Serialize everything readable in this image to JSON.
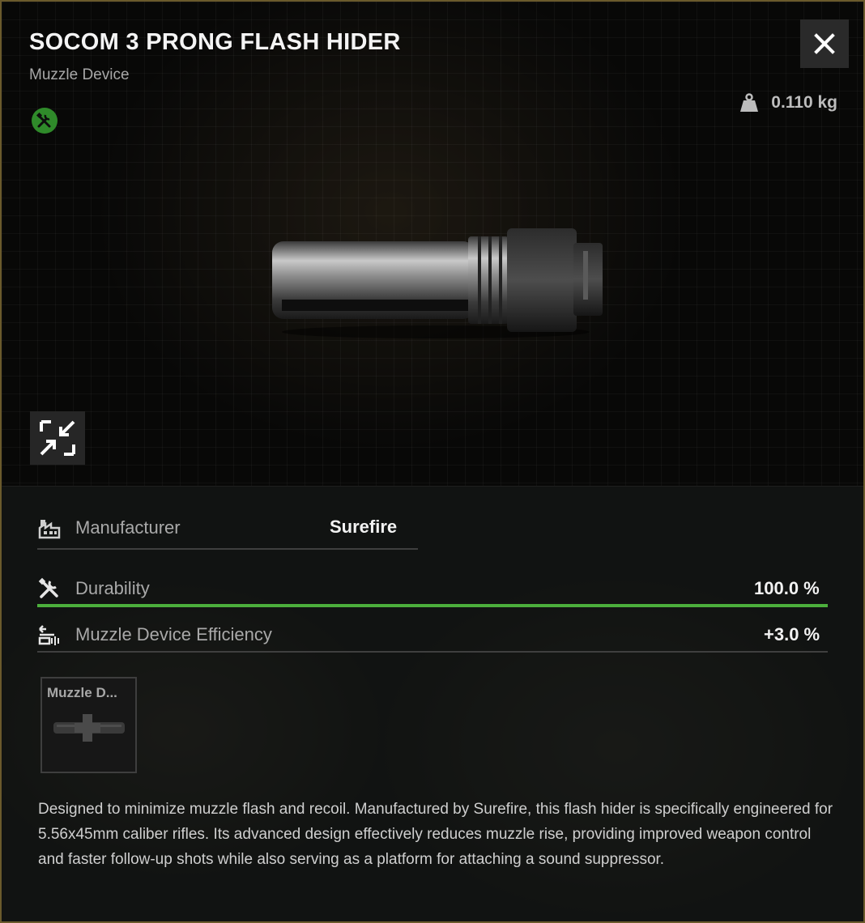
{
  "item": {
    "name": "SOCOM 3 PRONG FLASH HIDER",
    "category": "Muzzle Device",
    "weight": "0.110 kg"
  },
  "icons": {
    "status": "repair-tools-icon",
    "close": "close-icon",
    "weight": "weight-icon",
    "collapse": "collapse-arrows-icon",
    "manufacturer": "factory-icon",
    "durability": "tools-icon",
    "efficiency": "muzzle-efficiency-icon"
  },
  "stats": {
    "manufacturer": {
      "label": "Manufacturer",
      "value": "Surefire"
    },
    "durability": {
      "label": "Durability",
      "value": "100.0 %",
      "level": 1.0
    },
    "efficiency": {
      "label": "Muzzle Device Efficiency",
      "value": "+3.0 %"
    }
  },
  "slot": {
    "label": "Muzzle D..."
  },
  "description": "Designed to minimize muzzle flash and recoil. Manufactured by Surefire, this flash hider is specifically engineered for 5.56x45mm caliber rifles. Its advanced design effectively reduces muzzle rise, providing improved weapon control and faster follow-up shots while also serving as a platform for attaching a sound suppressor.",
  "colors": {
    "accent_green": "#4caf3c",
    "border_gold": "#6b5a2c",
    "status_green": "#2f8a2a"
  }
}
